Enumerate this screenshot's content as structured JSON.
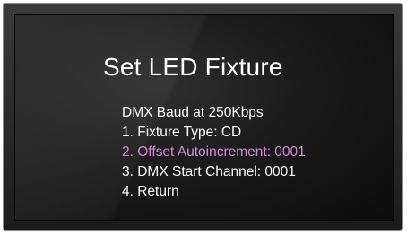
{
  "screen": {
    "title": "Set LED Fixture",
    "status": "DMX Baud at 250Kbps",
    "menu_items": [
      {
        "label": "1. Fixture Type: CD",
        "selected": false
      },
      {
        "label": "2. Offset Autoincrement: 0001",
        "selected": true
      },
      {
        "label": "3. DMX Start Channel: 0001",
        "selected": false
      },
      {
        "label": "4. Return",
        "selected": false
      }
    ],
    "highlight_color": "#d68ad6",
    "text_color": "#ffffff",
    "background_color": "#1a1a1a"
  }
}
